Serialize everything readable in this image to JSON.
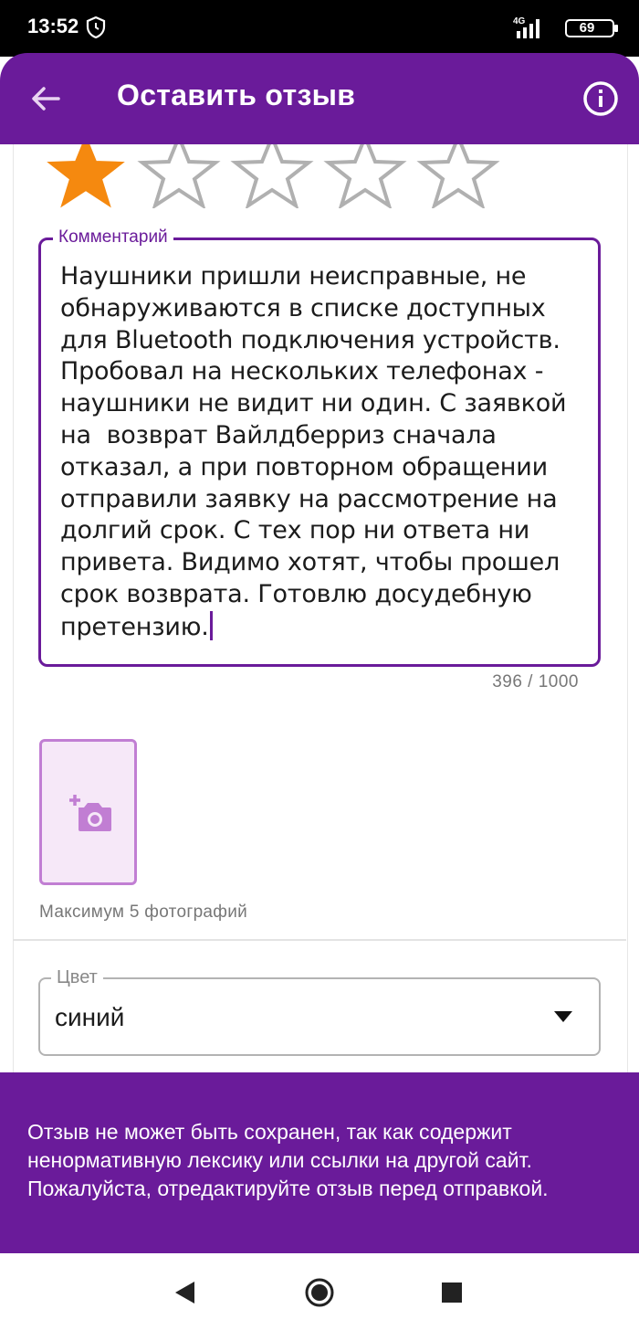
{
  "status_bar": {
    "time": "13:52",
    "network": "4G",
    "battery": "69"
  },
  "app_bar": {
    "title": "Оставить отзыв",
    "back_icon": "arrow-left-icon",
    "info_icon": "info-icon"
  },
  "rating": {
    "value": 1,
    "max": 5,
    "filled_color": "#f5890f",
    "empty_color": "#b0b0b0"
  },
  "comment": {
    "label": "Комментарий",
    "text": "Наушники пришли неисправные, не обнаруживаются в списке доступных для Bluetooth подключения устройств. Пробовал на нескольких телефонах - наушники не видит ни один. С заявкой на  возврат Вайлдберриз сначала отказал, а при повторном обращении отправили заявку на рассмотрение на долгий срок. С тех пор ни ответа ни привета. Видимо хотят, чтобы прошел срок возврата. Готовлю досудебную претензию.",
    "counter": "396 / 1000"
  },
  "photos": {
    "add_icon": "add-photo-icon",
    "note": "Максимум 5 фотографий"
  },
  "color_field": {
    "label": "Цвет",
    "value": "синий"
  },
  "snackbar": {
    "message": "Отзыв не может быть сохранен, так как содержит ненормативную лексику или ссылки на другой сайт. Пожалуйста, отредактируйте отзыв перед отправкой."
  },
  "theme": {
    "primary": "#6a1b9a",
    "accent_light": "#c17ed3"
  }
}
